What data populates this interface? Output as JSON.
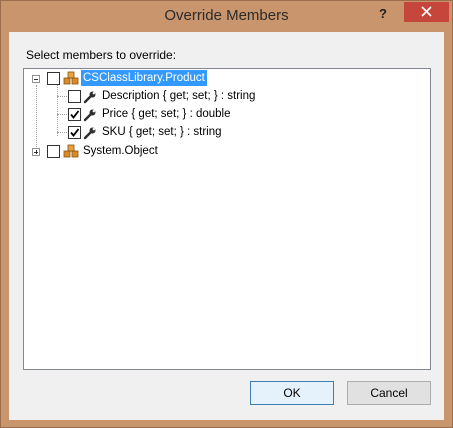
{
  "window": {
    "title": "Override Members",
    "help_label": "?"
  },
  "prompt": "Select members to override:",
  "tree": {
    "root_class": {
      "label": "CSClassLibrary.Product",
      "checked": false,
      "expanded": true,
      "icon": "class-icon"
    },
    "members": [
      {
        "label": "Description { get; set; } : string",
        "checked": false,
        "icon": "wrench-icon"
      },
      {
        "label": "Price { get; set; } : double",
        "checked": true,
        "icon": "wrench-icon"
      },
      {
        "label": "SKU { get; set; } : string",
        "checked": true,
        "icon": "wrench-icon"
      }
    ],
    "base_class": {
      "label": "System.Object",
      "checked": false,
      "expanded": false,
      "icon": "class-icon"
    }
  },
  "buttons": {
    "ok": "OK",
    "cancel": "Cancel"
  },
  "colors": {
    "title_bar": "#c8956d",
    "close_button": "#c7463c",
    "selection": "#3399ff"
  }
}
